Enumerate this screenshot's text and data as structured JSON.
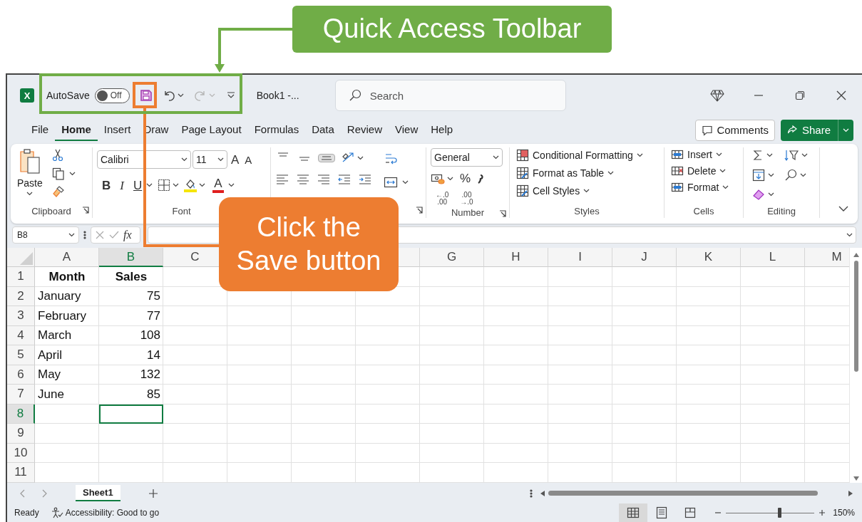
{
  "annotations": {
    "toolbar_label": "Quick Access Toolbar",
    "save_label": "Click the\nSave button"
  },
  "title_bar": {
    "logo_letter": "X",
    "autosave": {
      "label": "AutoSave",
      "state": "Off",
      "on": false
    },
    "undo": {
      "disabled": false
    },
    "redo": {
      "disabled": true
    },
    "document_title": "Book1  -...",
    "search_placeholder": "Search"
  },
  "menu_tabs": [
    {
      "label": "File",
      "selected": false
    },
    {
      "label": "Home",
      "selected": true
    },
    {
      "label": "Insert",
      "selected": false
    },
    {
      "label": "Draw",
      "selected": false
    },
    {
      "label": "Page Layout",
      "selected": false
    },
    {
      "label": "Formulas",
      "selected": false
    },
    {
      "label": "Data",
      "selected": false
    },
    {
      "label": "Review",
      "selected": false
    },
    {
      "label": "View",
      "selected": false
    },
    {
      "label": "Help",
      "selected": false
    }
  ],
  "header_buttons": {
    "comments": "Comments",
    "share": "Share"
  },
  "ribbon": {
    "clipboard": {
      "label": "Clipboard",
      "paste": "Paste"
    },
    "font": {
      "label": "Font",
      "name": "Calibri",
      "size": "11",
      "grow": "A",
      "shrink": "A",
      "bold": "B",
      "italic": "I",
      "underline": "U",
      "color_letter": "A"
    },
    "number": {
      "label": "Number",
      "format": "General",
      "percent": "%",
      "decimals": [
        {
          "top": "←.0",
          "bottom": ".00"
        },
        {
          "top": ".00",
          "bottom": "→.0"
        }
      ]
    },
    "styles": {
      "label": "Styles",
      "items": [
        "Conditional Formatting",
        "Format as Table",
        "Cell Styles"
      ]
    },
    "cells": {
      "label": "Cells",
      "items": [
        "Insert",
        "Delete",
        "Format"
      ]
    },
    "editing": {
      "label": "Editing"
    }
  },
  "formula_bar": {
    "name_box": "B8",
    "function_label": "fx"
  },
  "sheet": {
    "columns": [
      {
        "label": "A",
        "selected": false
      },
      {
        "label": "B",
        "selected": true
      },
      {
        "label": "C",
        "selected": false
      },
      {
        "kind": "covered"
      },
      {
        "label": "G",
        "selected": false
      },
      {
        "label": "H",
        "selected": false
      },
      {
        "label": "I",
        "selected": false
      },
      {
        "label": "J",
        "selected": false
      },
      {
        "label": "K",
        "selected": false
      },
      {
        "label": "L",
        "selected": false
      },
      {
        "label": "M",
        "selected": false
      }
    ],
    "rows": [
      {
        "number": "1",
        "selected": false,
        "kind": "header",
        "cells": [
          "Month",
          "Sales"
        ]
      },
      {
        "number": "2",
        "selected": false,
        "kind": "data",
        "cells": [
          "January",
          "75"
        ]
      },
      {
        "number": "3",
        "selected": false,
        "kind": "data",
        "cells": [
          "February",
          "77"
        ]
      },
      {
        "number": "4",
        "selected": false,
        "kind": "data",
        "cells": [
          "March",
          "108"
        ]
      },
      {
        "number": "5",
        "selected": false,
        "kind": "data",
        "cells": [
          "April",
          "14"
        ]
      },
      {
        "number": "6",
        "selected": false,
        "kind": "data",
        "cells": [
          "May",
          "132"
        ]
      },
      {
        "number": "7",
        "selected": false,
        "kind": "data",
        "cells": [
          "June",
          "85"
        ]
      },
      {
        "number": "8",
        "selected": true
      },
      {
        "number": "9",
        "selected": false
      },
      {
        "number": "10",
        "selected": false
      },
      {
        "number": "11",
        "selected": false
      }
    ]
  },
  "sheet_tabs": [
    {
      "label": "Sheet1",
      "selected": true
    }
  ],
  "status_bar": {
    "status": "Ready",
    "accessibility": "Accessibility: Good to go",
    "views": [
      {
        "kind": "normal",
        "selected": true
      },
      {
        "kind": "page_layout",
        "selected": false
      },
      {
        "kind": "page_break",
        "selected": false
      }
    ],
    "zoom": {
      "level": 0.6,
      "reading": "150%"
    }
  }
}
